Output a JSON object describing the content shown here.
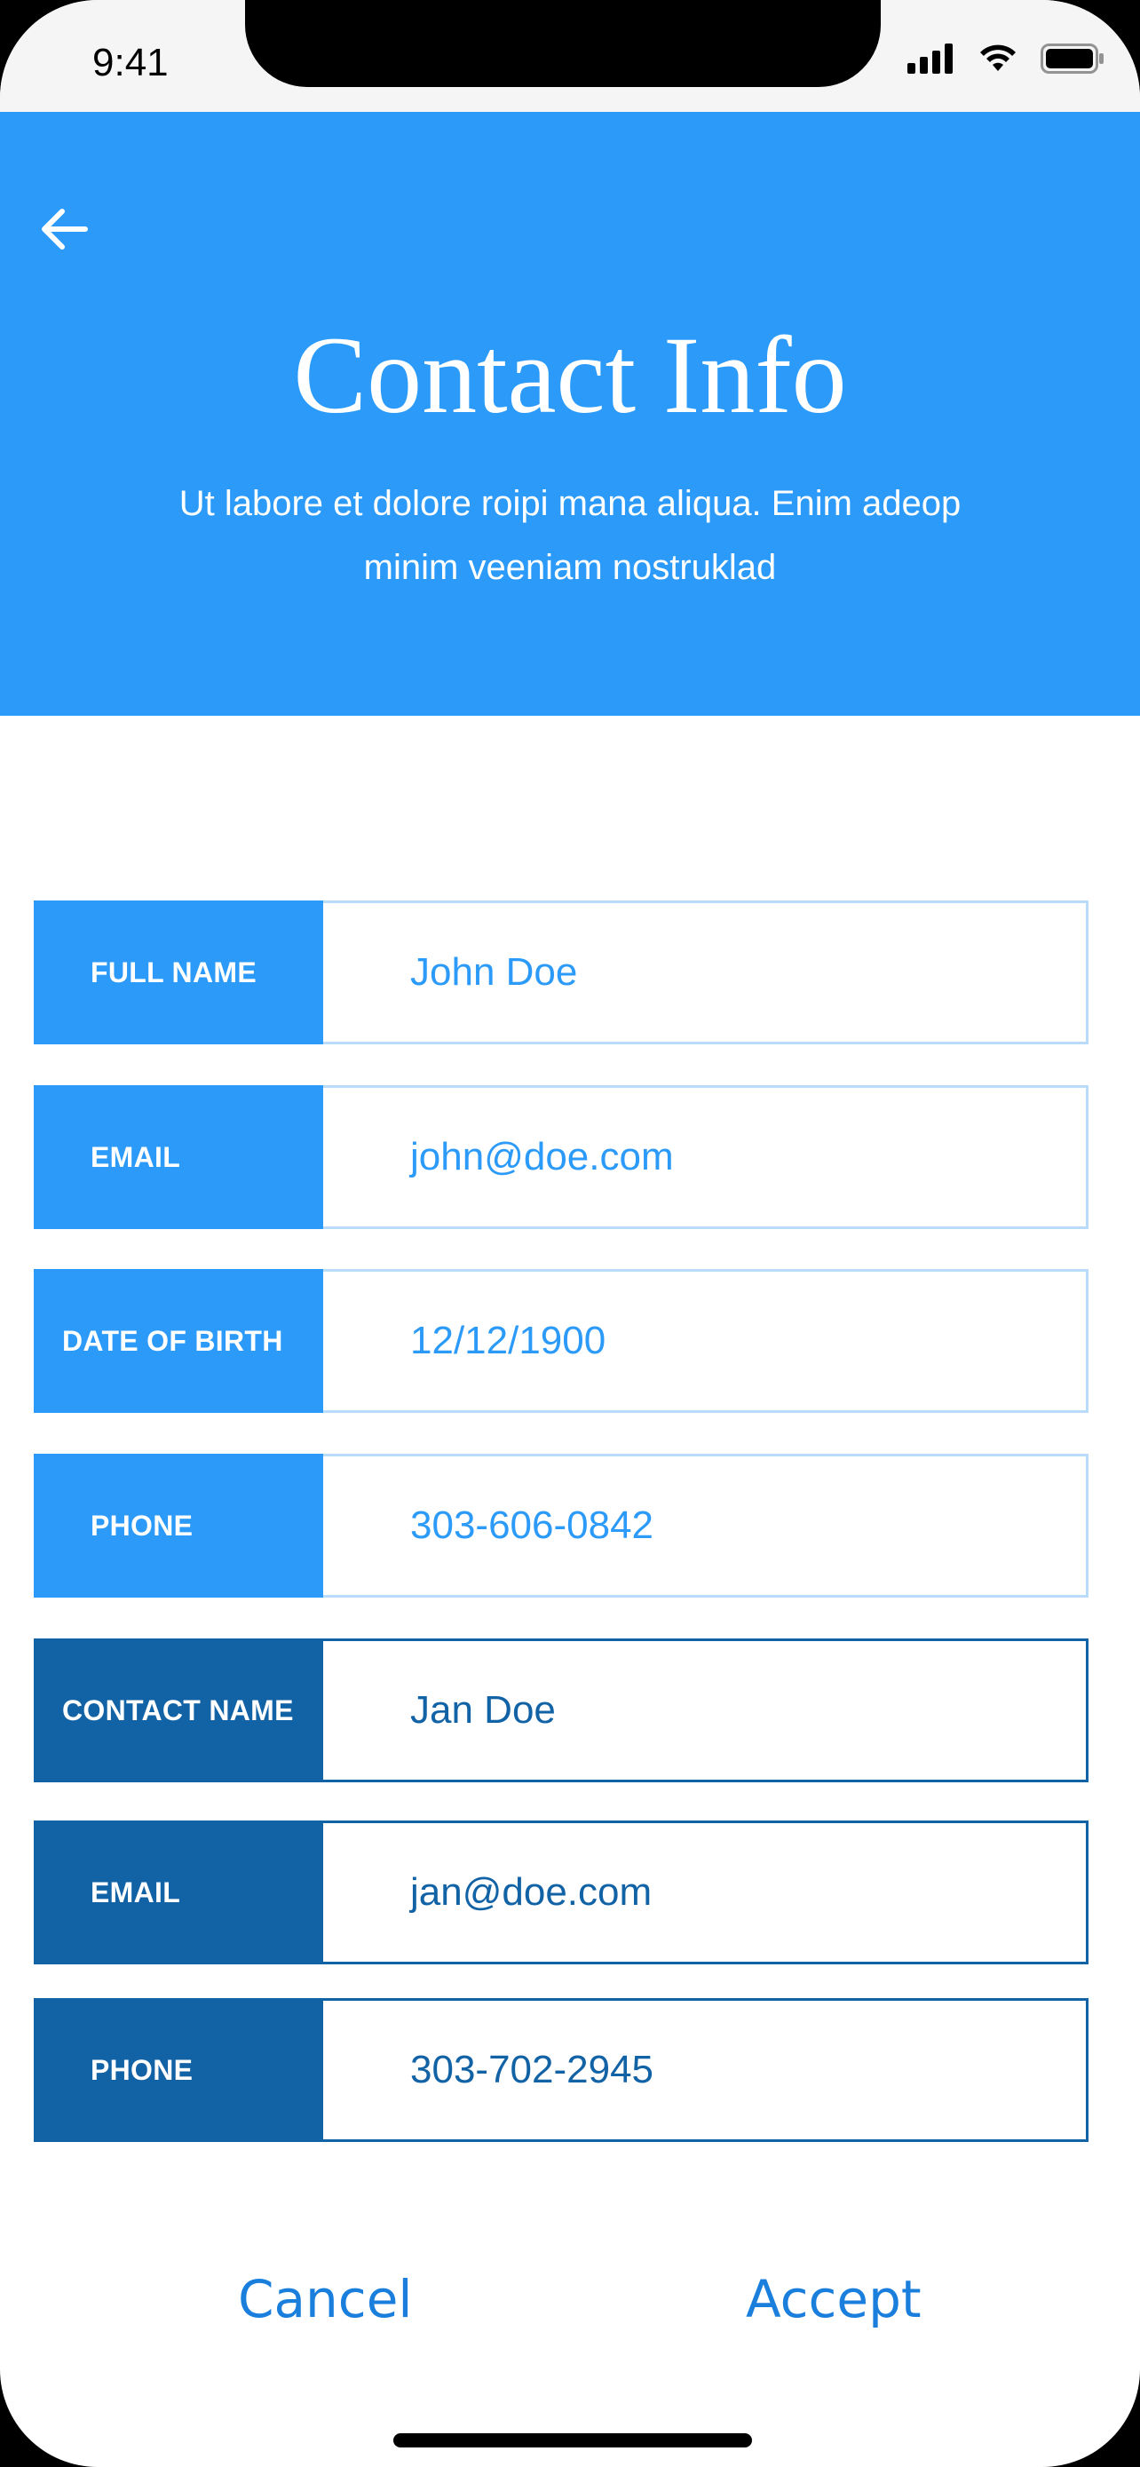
{
  "status_bar": {
    "time": "9:41"
  },
  "header": {
    "back_icon": "arrow-left-icon",
    "title": "Contact Info",
    "subtitle": "Ut labore et dolore roipi mana aliqua. Enim adeop minim veeniam nostruklad"
  },
  "form": {
    "rows": [
      {
        "label": "FULL NAME",
        "value": "John Doe"
      },
      {
        "label": "EMAIL",
        "value": "john@doe.com"
      },
      {
        "label": "DATE OF BIRTH",
        "value": "12/12/1900"
      },
      {
        "label": "PHONE",
        "value": "303-606-0842"
      },
      {
        "label": "CONTACT NAME",
        "value": "Jan Doe"
      },
      {
        "label": "EMAIL",
        "value": "jan@doe.com"
      },
      {
        "label": "PHONE",
        "value": "303-702-2945"
      }
    ]
  },
  "actions": {
    "cancel_label": "Cancel",
    "accept_label": "Accept"
  },
  "colors": {
    "primary": "#2b9af8",
    "primary_dark": "#1262a6",
    "action_text": "#1a7fdc",
    "light_border": "#b9dcfb"
  }
}
